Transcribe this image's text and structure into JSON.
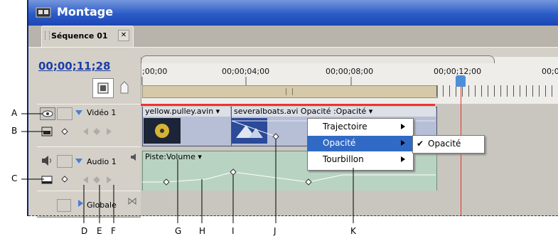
{
  "window": {
    "title": "Montage"
  },
  "tab": {
    "label": "Séquence 01",
    "close": "✕"
  },
  "header": {
    "timecode": "00;00;11;28"
  },
  "ruler": {
    "ticks": [
      ";00;00",
      "00;00;04;00",
      "00;00;08;00",
      "00;00;12;00",
      "00;0"
    ]
  },
  "tracks": {
    "video": {
      "name": "Vidéo 1"
    },
    "audio": {
      "name": "Audio 1"
    },
    "master": {
      "name": "Globale"
    }
  },
  "clips": {
    "video1": {
      "name": "yellow.pulley.avi",
      "suffix": "n ▾"
    },
    "video2": {
      "name": "severalboats.avi",
      "effect": "Opacité :Opacité ▾"
    },
    "audio": {
      "label": "Piste:Volume ▾"
    }
  },
  "context_menu": {
    "items": [
      {
        "label": "Trajectoire"
      },
      {
        "label": "Opacité"
      },
      {
        "label": "Tourbillon"
      }
    ],
    "submenu": {
      "check": "✔",
      "label": "Opacité"
    }
  },
  "callouts": {
    "A": "A",
    "B": "B",
    "C": "C",
    "D": "D",
    "E": "E",
    "F": "F",
    "G": "G",
    "H": "H",
    "I": "I",
    "J": "J",
    "K": "K"
  },
  "colors": {
    "title_bar": "#2b5bc8",
    "cti": "#e53826",
    "menu_highlight": "#316ac5",
    "audio_clip": "#b9d3c2",
    "video_clip": "#b7bfd6"
  }
}
